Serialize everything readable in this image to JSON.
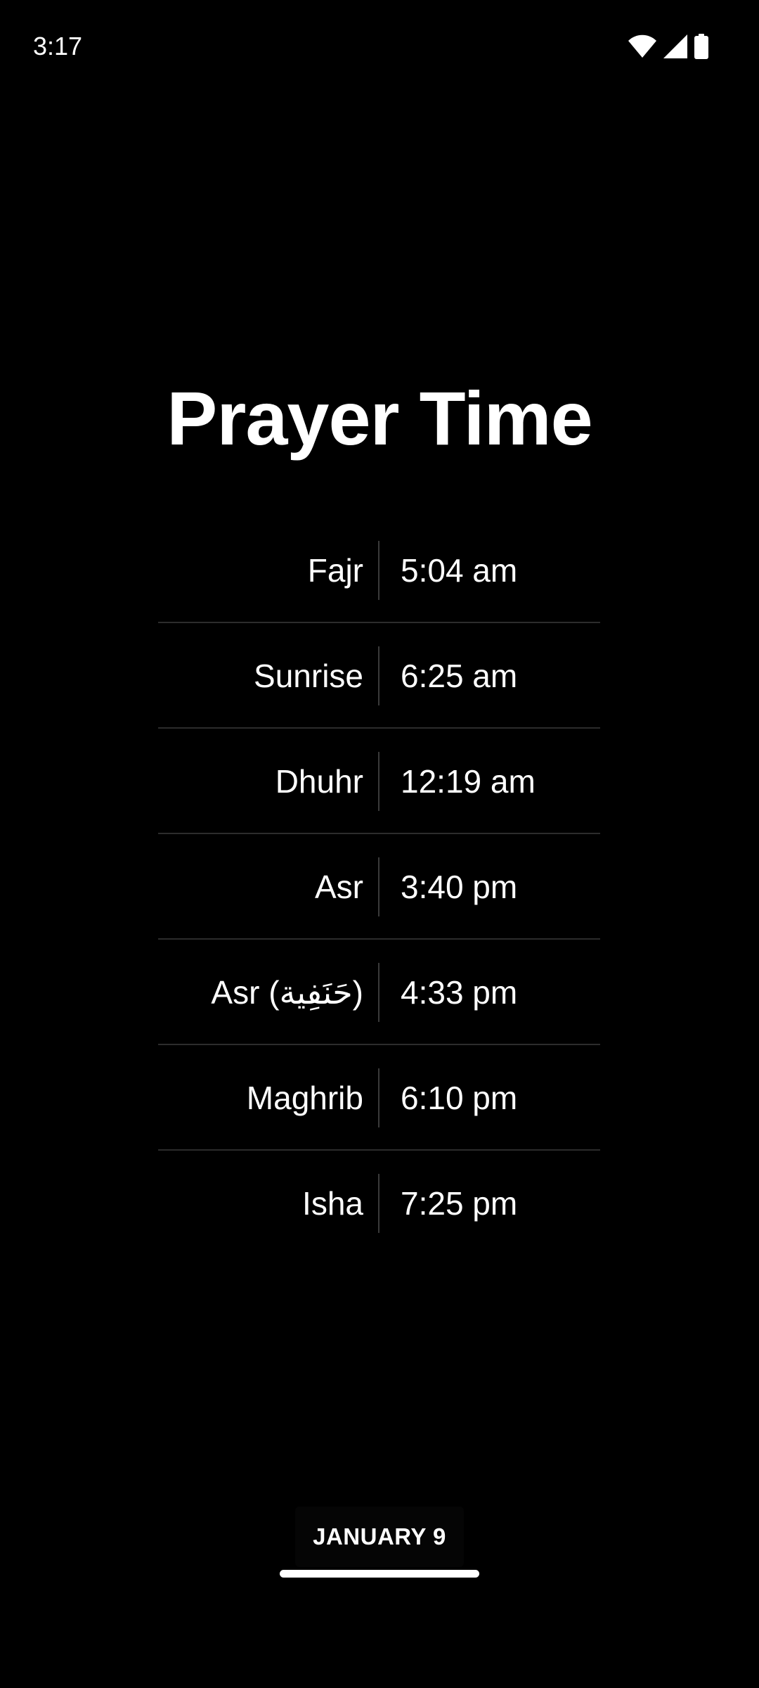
{
  "status_bar": {
    "time": "3:17",
    "icons": [
      "wifi-icon",
      "cellular-signal-icon",
      "battery-icon"
    ]
  },
  "title": "Prayer Time",
  "prayers": [
    {
      "name": "Fajr",
      "time": "5:04 am"
    },
    {
      "name": "Sunrise",
      "time": "6:25 am"
    },
    {
      "name": "Dhuhr",
      "time": "12:19 am"
    },
    {
      "name": "Asr",
      "time": "3:40 pm"
    },
    {
      "name": "Asr (حَنَفِية)",
      "time": "4:33 pm"
    },
    {
      "name": "Maghrib",
      "time": "6:10 pm"
    },
    {
      "name": "Isha",
      "time": "7:25 pm"
    }
  ],
  "date_label": "JANUARY 9",
  "colors": {
    "background": "#000000",
    "text": "#ffffff",
    "divider": "#2c2c2c"
  }
}
